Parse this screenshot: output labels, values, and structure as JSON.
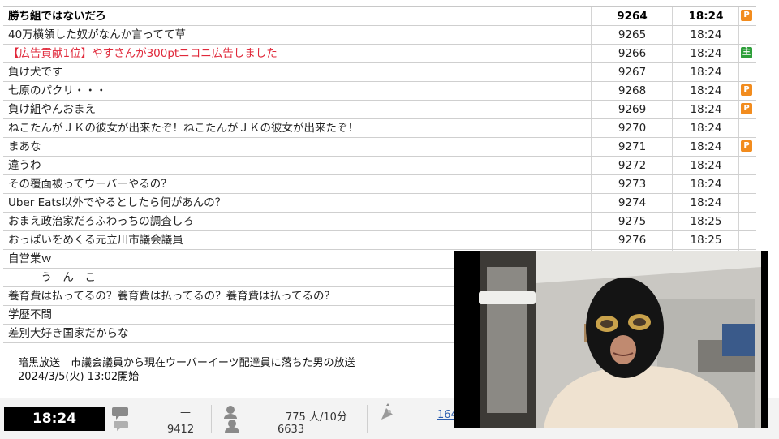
{
  "comments": [
    {
      "text": "勝ち組ではないだろ",
      "number": "9264",
      "time": "18:24",
      "badge": "premium",
      "style": "bold"
    },
    {
      "text": "40万横領した奴がなんか言ってて草",
      "number": "9265",
      "time": "18:24",
      "badge": "",
      "style": ""
    },
    {
      "text": "【広告貢献1位】やすさんが300ptニコニ広告しました",
      "number": "9266",
      "time": "18:24",
      "badge": "owner",
      "style": "red"
    },
    {
      "text": "負け犬です",
      "number": "9267",
      "time": "18:24",
      "badge": "",
      "style": ""
    },
    {
      "text": "七原のパクリ・・・",
      "number": "9268",
      "time": "18:24",
      "badge": "premium",
      "style": ""
    },
    {
      "text": "負け組やんおまえ",
      "number": "9269",
      "time": "18:24",
      "badge": "premium",
      "style": ""
    },
    {
      "text": "ねこたんがＪＫの彼女が出来たぞ！ねこたんがＪＫの彼女が出来たぞ！",
      "number": "9270",
      "time": "18:24",
      "badge": "",
      "style": ""
    },
    {
      "text": "まあな",
      "number": "9271",
      "time": "18:24",
      "badge": "premium",
      "style": ""
    },
    {
      "text": "違うわ",
      "number": "9272",
      "time": "18:24",
      "badge": "",
      "style": ""
    },
    {
      "text": "その覆面被ってウーバーやるの？",
      "number": "9273",
      "time": "18:24",
      "badge": "",
      "style": ""
    },
    {
      "text": "Uber Eats以外でやるとしたら何があんの？",
      "number": "9274",
      "time": "18:24",
      "badge": "",
      "style": ""
    },
    {
      "text": "おまえ政治家だろふわっちの調査しろ",
      "number": "9275",
      "time": "18:25",
      "badge": "",
      "style": ""
    },
    {
      "text": "おっぱいをめくる元立川市議会議員",
      "number": "9276",
      "time": "18:25",
      "badge": "",
      "style": ""
    },
    {
      "text": "自営業ｗ",
      "number": "",
      "time": "",
      "badge": "",
      "style": ""
    },
    {
      "text": "　　　う　ん　こ",
      "number": "",
      "time": "",
      "badge": "",
      "style": ""
    },
    {
      "text": "養育費は払ってるの？養育費は払ってるの？養育費は払ってるの？",
      "number": "",
      "time": "",
      "badge": "",
      "style": ""
    },
    {
      "text": "学歴不問",
      "number": "",
      "time": "",
      "badge": "",
      "style": ""
    },
    {
      "text": "差別大好き国家だからな",
      "number": "",
      "time": "",
      "badge": "",
      "style": ""
    }
  ],
  "badges": {
    "premium": "P",
    "owner": "主"
  },
  "broadcast": {
    "title": "暗黒放送　市議会議員から現在ウーバーイーツ配達員に落ちた男の放送",
    "start": "2024/3/5(火) 13:02開始"
  },
  "status": {
    "clock": "18:24",
    "dash": "—",
    "comment_total": "9412",
    "viewer_rate": "775 人/10分",
    "visitors": "6633",
    "link_text": "164"
  },
  "colors": {
    "premium_badge": "#f28c1e",
    "owner_badge": "#2e9f3a",
    "ad_text": "#e0283a",
    "clock_bg": "#000000"
  },
  "icons": [
    "comment-icon",
    "viewer-icon",
    "ad-icon"
  ]
}
